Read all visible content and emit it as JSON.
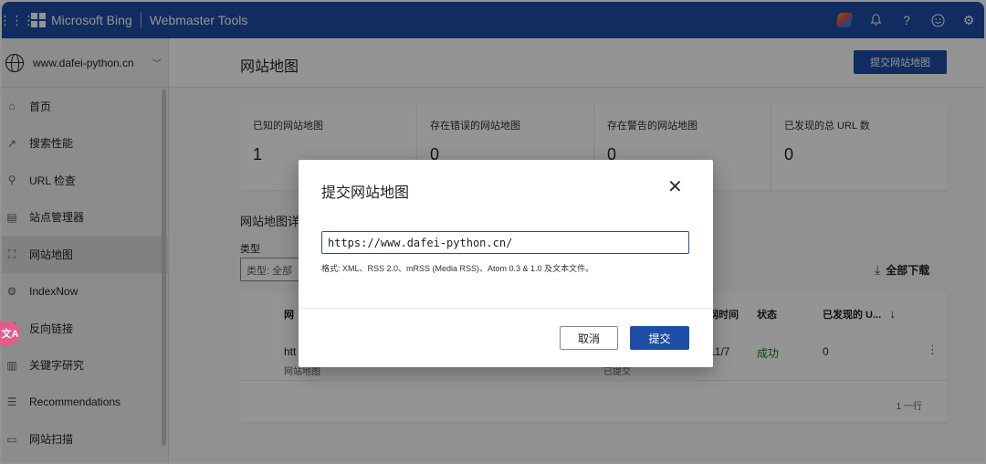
{
  "topbar": {
    "brand": "Microsoft Bing",
    "product": "Webmaster Tools",
    "icons": [
      "waffle-icon",
      "copilot-icon",
      "bell-icon",
      "help-icon",
      "feedback-icon",
      "settings-icon"
    ]
  },
  "sidebar": {
    "site": "www.dafei-python.cn",
    "items": [
      {
        "label": "首页",
        "icon": "home-icon"
      },
      {
        "label": "搜索性能",
        "icon": "trend-icon"
      },
      {
        "label": "URL 检查",
        "icon": "search-icon"
      },
      {
        "label": "站点管理器",
        "icon": "document-icon"
      },
      {
        "label": "网站地图",
        "icon": "sitemap-icon",
        "active": true
      },
      {
        "label": "IndexNow",
        "icon": "gear-icon"
      },
      {
        "label": "反向链接",
        "icon": "link-icon"
      },
      {
        "label": "关键字研究",
        "icon": "book-icon"
      },
      {
        "label": "Recommendations",
        "icon": "list-icon"
      },
      {
        "label": "网站扫描",
        "icon": "scan-icon"
      }
    ]
  },
  "header": {
    "title": "网站地图",
    "submit_label": "提交网站地图"
  },
  "stats": [
    {
      "label": "已知的网站地图",
      "value": "1"
    },
    {
      "label": "存在错误的网站地图",
      "value": "0"
    },
    {
      "label": "存在警告的网站地图",
      "value": "0"
    },
    {
      "label": "已发现的总 URL 数",
      "value": "0"
    }
  ],
  "details": {
    "title": "网站地图详",
    "filter_label": "类型",
    "filter_value": "类型: 全部",
    "download_all": "全部下载"
  },
  "table": {
    "headers": {
      "site": "网",
      "time": "网时间",
      "status": "状态",
      "discovered": "已发现的 U...",
      "sort_arrow": "↓"
    },
    "row": {
      "url": "htt",
      "type": "网站地图",
      "date": "11/7",
      "date_sub": "已提交",
      "status": "成功",
      "discovered": "0"
    },
    "pager": "1 一行"
  },
  "dialog": {
    "title": "提交网站地图",
    "input_value": "https://www.dafei-python.cn/",
    "help": "格式: XML、RSS 2.0、mRSS (Media RSS)、Atom 0.3 & 1.0 及文本文件。",
    "cancel_label": "取消",
    "submit_label": "提交"
  },
  "float_badge": "文A",
  "colors": {
    "brand_blue": "#1e4da6",
    "success_green": "#107c10",
    "overlay": "rgba(0,0,0,0.42)"
  }
}
